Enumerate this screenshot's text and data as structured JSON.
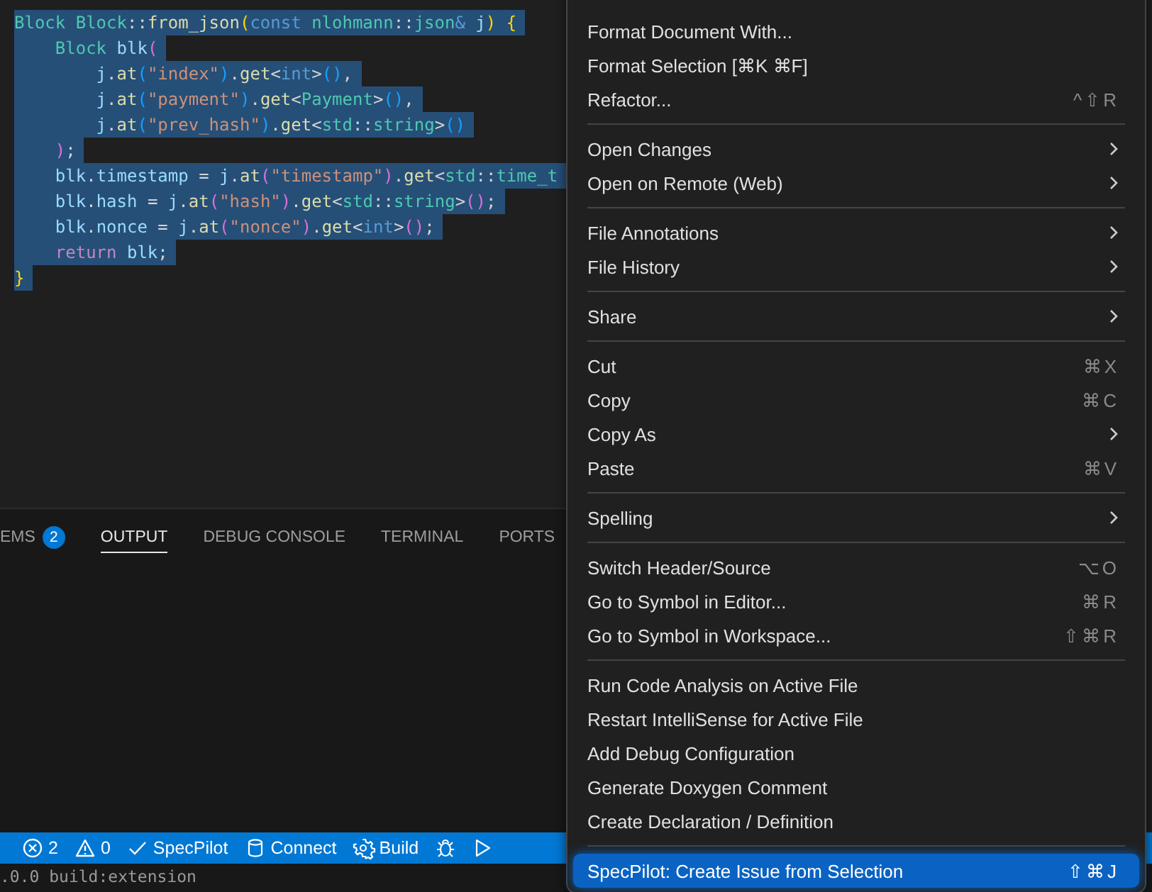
{
  "editor": {
    "lines": [
      {
        "selected": true,
        "tokens": [
          {
            "kind": "type",
            "text": "Block "
          },
          {
            "kind": "type",
            "text": "Block"
          },
          {
            "kind": "plain",
            "text": "::"
          },
          {
            "kind": "func",
            "text": "from_json"
          },
          {
            "kind": "b1",
            "text": "("
          },
          {
            "kind": "kw",
            "text": "const "
          },
          {
            "kind": "type",
            "text": "nlohmann"
          },
          {
            "kind": "plain",
            "text": "::"
          },
          {
            "kind": "type",
            "text": "json"
          },
          {
            "kind": "kw",
            "text": "& "
          },
          {
            "kind": "var",
            "text": "j"
          },
          {
            "kind": "b1",
            "text": ") "
          },
          {
            "kind": "b1",
            "text": "{"
          }
        ]
      },
      {
        "selected": true,
        "tokens": [
          {
            "kind": "type",
            "text": "    Block "
          },
          {
            "kind": "var",
            "text": "blk"
          },
          {
            "kind": "b2",
            "text": "("
          }
        ]
      },
      {
        "selected": true,
        "tokens": [
          {
            "kind": "var",
            "text": "        j"
          },
          {
            "kind": "plain",
            "text": "."
          },
          {
            "kind": "func",
            "text": "at"
          },
          {
            "kind": "b3",
            "text": "("
          },
          {
            "kind": "str",
            "text": "\"index\""
          },
          {
            "kind": "b3",
            "text": ")"
          },
          {
            "kind": "plain",
            "text": "."
          },
          {
            "kind": "func",
            "text": "get"
          },
          {
            "kind": "plain",
            "text": "<"
          },
          {
            "kind": "kw",
            "text": "int"
          },
          {
            "kind": "plain",
            "text": ">"
          },
          {
            "kind": "b3",
            "text": "()"
          },
          {
            "kind": "plain",
            "text": ","
          }
        ]
      },
      {
        "selected": true,
        "tokens": [
          {
            "kind": "var",
            "text": "        j"
          },
          {
            "kind": "plain",
            "text": "."
          },
          {
            "kind": "func",
            "text": "at"
          },
          {
            "kind": "b3",
            "text": "("
          },
          {
            "kind": "str",
            "text": "\"payment\""
          },
          {
            "kind": "b3",
            "text": ")"
          },
          {
            "kind": "plain",
            "text": "."
          },
          {
            "kind": "func",
            "text": "get"
          },
          {
            "kind": "plain",
            "text": "<"
          },
          {
            "kind": "type",
            "text": "Payment"
          },
          {
            "kind": "plain",
            "text": ">"
          },
          {
            "kind": "b3",
            "text": "()"
          },
          {
            "kind": "plain",
            "text": ","
          }
        ]
      },
      {
        "selected": true,
        "tokens": [
          {
            "kind": "var",
            "text": "        j"
          },
          {
            "kind": "plain",
            "text": "."
          },
          {
            "kind": "func",
            "text": "at"
          },
          {
            "kind": "b3",
            "text": "("
          },
          {
            "kind": "str",
            "text": "\"prev_hash\""
          },
          {
            "kind": "b3",
            "text": ")"
          },
          {
            "kind": "plain",
            "text": "."
          },
          {
            "kind": "func",
            "text": "get"
          },
          {
            "kind": "plain",
            "text": "<"
          },
          {
            "kind": "type",
            "text": "std"
          },
          {
            "kind": "plain",
            "text": "::"
          },
          {
            "kind": "type",
            "text": "string"
          },
          {
            "kind": "plain",
            "text": ">"
          },
          {
            "kind": "b3",
            "text": "()"
          }
        ]
      },
      {
        "selected": true,
        "tokens": [
          {
            "kind": "b2",
            "text": "    )"
          },
          {
            "kind": "plain",
            "text": ";"
          }
        ]
      },
      {
        "selected": true,
        "tokens": [
          {
            "kind": "var",
            "text": "    blk"
          },
          {
            "kind": "plain",
            "text": "."
          },
          {
            "kind": "var",
            "text": "timestamp"
          },
          {
            "kind": "plain",
            "text": " = "
          },
          {
            "kind": "var",
            "text": "j"
          },
          {
            "kind": "plain",
            "text": "."
          },
          {
            "kind": "func",
            "text": "at"
          },
          {
            "kind": "b2",
            "text": "("
          },
          {
            "kind": "str",
            "text": "\"timestamp\""
          },
          {
            "kind": "b2",
            "text": ")"
          },
          {
            "kind": "plain",
            "text": "."
          },
          {
            "kind": "func",
            "text": "get"
          },
          {
            "kind": "plain",
            "text": "<"
          },
          {
            "kind": "type",
            "text": "std"
          },
          {
            "kind": "plain",
            "text": "::"
          },
          {
            "kind": "type",
            "text": "time_t"
          }
        ]
      },
      {
        "selected": true,
        "tokens": [
          {
            "kind": "var",
            "text": "    blk"
          },
          {
            "kind": "plain",
            "text": "."
          },
          {
            "kind": "var",
            "text": "hash"
          },
          {
            "kind": "plain",
            "text": " = "
          },
          {
            "kind": "var",
            "text": "j"
          },
          {
            "kind": "plain",
            "text": "."
          },
          {
            "kind": "func",
            "text": "at"
          },
          {
            "kind": "b2",
            "text": "("
          },
          {
            "kind": "str",
            "text": "\"hash\""
          },
          {
            "kind": "b2",
            "text": ")"
          },
          {
            "kind": "plain",
            "text": "."
          },
          {
            "kind": "func",
            "text": "get"
          },
          {
            "kind": "plain",
            "text": "<"
          },
          {
            "kind": "type",
            "text": "std"
          },
          {
            "kind": "plain",
            "text": "::"
          },
          {
            "kind": "type",
            "text": "string"
          },
          {
            "kind": "plain",
            "text": ">"
          },
          {
            "kind": "b2",
            "text": "()"
          },
          {
            "kind": "plain",
            "text": ";"
          }
        ]
      },
      {
        "selected": true,
        "tokens": [
          {
            "kind": "var",
            "text": "    blk"
          },
          {
            "kind": "plain",
            "text": "."
          },
          {
            "kind": "var",
            "text": "nonce"
          },
          {
            "kind": "plain",
            "text": " = "
          },
          {
            "kind": "var",
            "text": "j"
          },
          {
            "kind": "plain",
            "text": "."
          },
          {
            "kind": "func",
            "text": "at"
          },
          {
            "kind": "b2",
            "text": "("
          },
          {
            "kind": "str",
            "text": "\"nonce\""
          },
          {
            "kind": "b2",
            "text": ")"
          },
          {
            "kind": "plain",
            "text": "."
          },
          {
            "kind": "func",
            "text": "get"
          },
          {
            "kind": "plain",
            "text": "<"
          },
          {
            "kind": "kw",
            "text": "int"
          },
          {
            "kind": "plain",
            "text": ">"
          },
          {
            "kind": "b2",
            "text": "()"
          },
          {
            "kind": "plain",
            "text": ";"
          }
        ]
      },
      {
        "selected": true,
        "tokens": [
          {
            "kind": "ctrl",
            "text": "    return "
          },
          {
            "kind": "var",
            "text": "blk"
          },
          {
            "kind": "plain",
            "text": ";"
          }
        ]
      },
      {
        "selected": true,
        "tokens": [
          {
            "kind": "b1",
            "text": "}"
          }
        ]
      }
    ]
  },
  "panel": {
    "tabs": [
      {
        "label": "EMS",
        "badge": "2",
        "selected": false
      },
      {
        "label": "OUTPUT",
        "selected": true
      },
      {
        "label": "DEBUG CONSOLE",
        "selected": false
      },
      {
        "label": "TERMINAL",
        "selected": false
      },
      {
        "label": "PORTS",
        "selected": false
      }
    ]
  },
  "status_bar": {
    "items": [
      {
        "kind": "errors",
        "label": "2"
      },
      {
        "kind": "warnings",
        "label": "0"
      },
      {
        "kind": "check",
        "label": "SpecPilot"
      },
      {
        "kind": "database",
        "label": "Connect"
      },
      {
        "kind": "gear",
        "label": "Build"
      },
      {
        "kind": "bug"
      },
      {
        "kind": "play"
      }
    ]
  },
  "terminal": {
    "lines": [
      ".0.0 build:extension"
    ]
  },
  "context_menu": {
    "groups": [
      {
        "items": [
          {
            "label": "Format Document With...",
            "submenu": false,
            "selected": false
          },
          {
            "label": "Format Selection [⌘K ⌘F]",
            "submenu": false,
            "selected": false
          },
          {
            "label": "Refactor...",
            "shortcut": "^⇧R",
            "submenu": false,
            "selected": false
          }
        ]
      },
      {
        "items": [
          {
            "label": "Open Changes",
            "submenu": true,
            "selected": false
          },
          {
            "label": "Open on Remote (Web)",
            "submenu": true,
            "selected": false
          }
        ]
      },
      {
        "items": [
          {
            "label": "File Annotations",
            "submenu": true,
            "selected": false
          },
          {
            "label": "File History",
            "submenu": true,
            "selected": false
          }
        ]
      },
      {
        "items": [
          {
            "label": "Share",
            "submenu": true,
            "selected": false
          }
        ]
      },
      {
        "items": [
          {
            "label": "Cut",
            "shortcut": "⌘X",
            "submenu": false,
            "selected": false
          },
          {
            "label": "Copy",
            "shortcut": "⌘C",
            "submenu": false,
            "selected": false
          },
          {
            "label": "Copy As",
            "submenu": true,
            "selected": false
          },
          {
            "label": "Paste",
            "shortcut": "⌘V",
            "submenu": false,
            "selected": false
          }
        ]
      },
      {
        "items": [
          {
            "label": "Spelling",
            "submenu": true,
            "selected": false
          }
        ]
      },
      {
        "items": [
          {
            "label": "Switch Header/Source",
            "shortcut": "⌥O",
            "submenu": false,
            "selected": false
          },
          {
            "label": "Go to Symbol in Editor...",
            "shortcut": "⌘R",
            "submenu": false,
            "selected": false
          },
          {
            "label": "Go to Symbol in Workspace...",
            "shortcut": "⇧⌘R",
            "submenu": false,
            "selected": false
          }
        ]
      },
      {
        "items": [
          {
            "label": "Run Code Analysis on Active File",
            "submenu": false,
            "selected": false
          },
          {
            "label": "Restart IntelliSense for Active File",
            "submenu": false,
            "selected": false
          },
          {
            "label": "Add Debug Configuration",
            "submenu": false,
            "selected": false
          },
          {
            "label": "Generate Doxygen Comment",
            "submenu": false,
            "selected": false
          },
          {
            "label": "Create Declaration / Definition",
            "submenu": false,
            "selected": false
          }
        ]
      },
      {
        "items": [
          {
            "label": "SpecPilot: Create Issue from Selection",
            "shortcut": "⇧⌘J",
            "submenu": false,
            "selected": true
          }
        ]
      }
    ]
  }
}
